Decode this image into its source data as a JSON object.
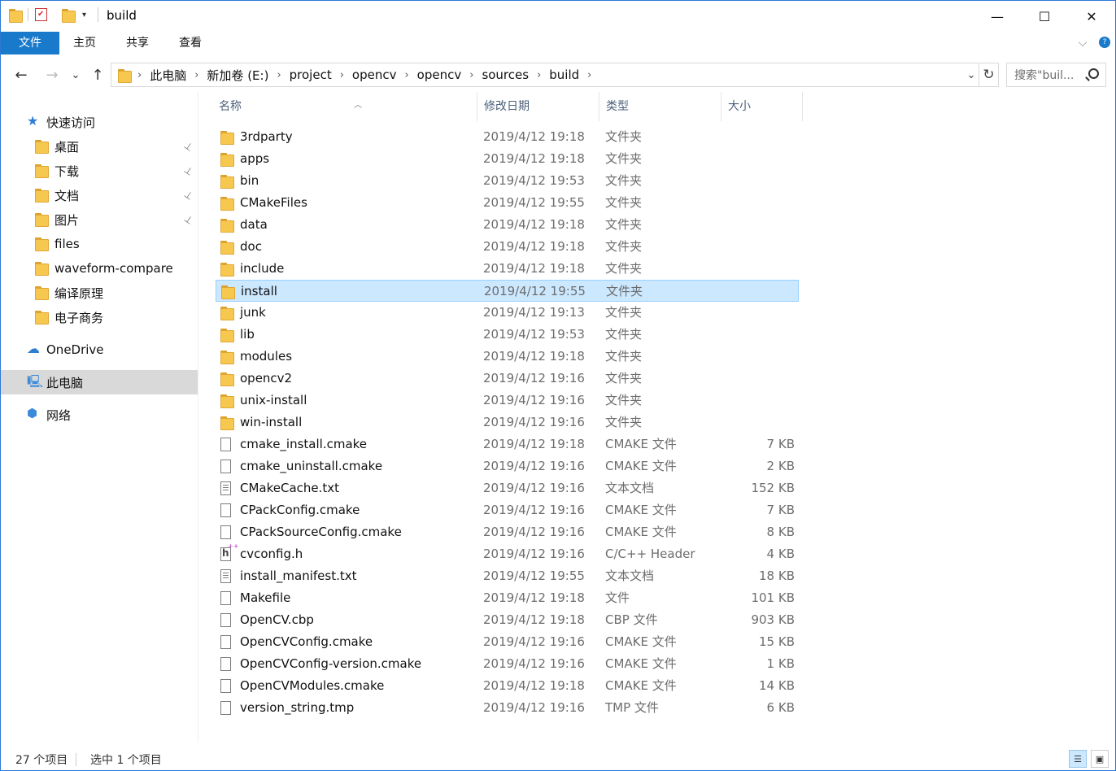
{
  "window": {
    "title": "build",
    "controls": {
      "minimize": "—",
      "maximize": "☐",
      "close": "✕"
    }
  },
  "ribbon": {
    "tabs": [
      "文件",
      "主页",
      "共享",
      "查看"
    ],
    "expand_glyph": "⌵",
    "help_glyph": "?"
  },
  "nav": {
    "back": "←",
    "forward": "→",
    "recent": "⌄",
    "up": "↑",
    "breadcrumbs": [
      "此电脑",
      "新加卷 (E:)",
      "project",
      "opencv",
      "opencv",
      "sources",
      "build"
    ],
    "separator": "›",
    "dropdown": "⌄",
    "refresh": "↻",
    "search_placeholder": "搜索\"buil..."
  },
  "sidebar": {
    "items": [
      {
        "label": "快速访问",
        "icon": "star-icon",
        "pinned": false
      },
      {
        "label": "桌面",
        "icon": "desktop-folder-icon",
        "pinned": true
      },
      {
        "label": "下载",
        "icon": "downloads-icon",
        "pinned": true
      },
      {
        "label": "文档",
        "icon": "documents-icon",
        "pinned": true
      },
      {
        "label": "图片",
        "icon": "pictures-icon",
        "pinned": true
      },
      {
        "label": "files",
        "icon": "folder-icon",
        "pinned": false
      },
      {
        "label": "waveform-compare",
        "icon": "folder-icon",
        "pinned": false
      },
      {
        "label": "编译原理",
        "icon": "folder-icon",
        "pinned": false
      },
      {
        "label": "电子商务",
        "icon": "folder-icon",
        "pinned": false
      },
      {
        "label": "OneDrive",
        "icon": "cloud-icon",
        "pinned": false
      },
      {
        "label": "此电脑",
        "icon": "computer-icon",
        "pinned": false
      },
      {
        "label": "网络",
        "icon": "network-icon",
        "pinned": false
      }
    ],
    "pin_glyph": "📌"
  },
  "columns": {
    "name": "名称",
    "modified": "修改日期",
    "type": "类型",
    "size": "大小",
    "sort_glyph": "︿"
  },
  "files": [
    {
      "name": "3rdparty",
      "modified": "2019/4/12 19:18",
      "type": "文件夹",
      "size": "",
      "kind": "folder"
    },
    {
      "name": "apps",
      "modified": "2019/4/12 19:18",
      "type": "文件夹",
      "size": "",
      "kind": "folder"
    },
    {
      "name": "bin",
      "modified": "2019/4/12 19:53",
      "type": "文件夹",
      "size": "",
      "kind": "folder"
    },
    {
      "name": "CMakeFiles",
      "modified": "2019/4/12 19:55",
      "type": "文件夹",
      "size": "",
      "kind": "folder"
    },
    {
      "name": "data",
      "modified": "2019/4/12 19:18",
      "type": "文件夹",
      "size": "",
      "kind": "folder"
    },
    {
      "name": "doc",
      "modified": "2019/4/12 19:18",
      "type": "文件夹",
      "size": "",
      "kind": "folder"
    },
    {
      "name": "include",
      "modified": "2019/4/12 19:18",
      "type": "文件夹",
      "size": "",
      "kind": "folder"
    },
    {
      "name": "install",
      "modified": "2019/4/12 19:55",
      "type": "文件夹",
      "size": "",
      "kind": "folder",
      "selected": true
    },
    {
      "name": "junk",
      "modified": "2019/4/12 19:13",
      "type": "文件夹",
      "size": "",
      "kind": "folder"
    },
    {
      "name": "lib",
      "modified": "2019/4/12 19:53",
      "type": "文件夹",
      "size": "",
      "kind": "folder"
    },
    {
      "name": "modules",
      "modified": "2019/4/12 19:18",
      "type": "文件夹",
      "size": "",
      "kind": "folder"
    },
    {
      "name": "opencv2",
      "modified": "2019/4/12 19:16",
      "type": "文件夹",
      "size": "",
      "kind": "folder"
    },
    {
      "name": "unix-install",
      "modified": "2019/4/12 19:16",
      "type": "文件夹",
      "size": "",
      "kind": "folder"
    },
    {
      "name": "win-install",
      "modified": "2019/4/12 19:16",
      "type": "文件夹",
      "size": "",
      "kind": "folder"
    },
    {
      "name": "cmake_install.cmake",
      "modified": "2019/4/12 19:18",
      "type": "CMAKE 文件",
      "size": "7 KB",
      "kind": "file"
    },
    {
      "name": "cmake_uninstall.cmake",
      "modified": "2019/4/12 19:16",
      "type": "CMAKE 文件",
      "size": "2 KB",
      "kind": "file"
    },
    {
      "name": "CMakeCache.txt",
      "modified": "2019/4/12 19:16",
      "type": "文本文档",
      "size": "152 KB",
      "kind": "txt"
    },
    {
      "name": "CPackConfig.cmake",
      "modified": "2019/4/12 19:16",
      "type": "CMAKE 文件",
      "size": "7 KB",
      "kind": "file"
    },
    {
      "name": "CPackSourceConfig.cmake",
      "modified": "2019/4/12 19:16",
      "type": "CMAKE 文件",
      "size": "8 KB",
      "kind": "file"
    },
    {
      "name": "cvconfig.h",
      "modified": "2019/4/12 19:16",
      "type": "C/C++ Header",
      "size": "4 KB",
      "kind": "h"
    },
    {
      "name": "install_manifest.txt",
      "modified": "2019/4/12 19:55",
      "type": "文本文档",
      "size": "18 KB",
      "kind": "txt"
    },
    {
      "name": "Makefile",
      "modified": "2019/4/12 19:18",
      "type": "文件",
      "size": "101 KB",
      "kind": "file"
    },
    {
      "name": "OpenCV.cbp",
      "modified": "2019/4/12 19:18",
      "type": "CBP 文件",
      "size": "903 KB",
      "kind": "file"
    },
    {
      "name": "OpenCVConfig.cmake",
      "modified": "2019/4/12 19:16",
      "type": "CMAKE 文件",
      "size": "15 KB",
      "kind": "file"
    },
    {
      "name": "OpenCVConfig-version.cmake",
      "modified": "2019/4/12 19:16",
      "type": "CMAKE 文件",
      "size": "1 KB",
      "kind": "file"
    },
    {
      "name": "OpenCVModules.cmake",
      "modified": "2019/4/12 19:18",
      "type": "CMAKE 文件",
      "size": "14 KB",
      "kind": "file"
    },
    {
      "name": "version_string.tmp",
      "modified": "2019/4/12 19:16",
      "type": "TMP 文件",
      "size": "6 KB",
      "kind": "file"
    }
  ],
  "status": {
    "item_count": "27 个项目",
    "selected": "选中 1 个项目"
  },
  "colors": {
    "accent": "#1979ca",
    "selection": "#cce8ff",
    "folder": "#f7c850"
  }
}
